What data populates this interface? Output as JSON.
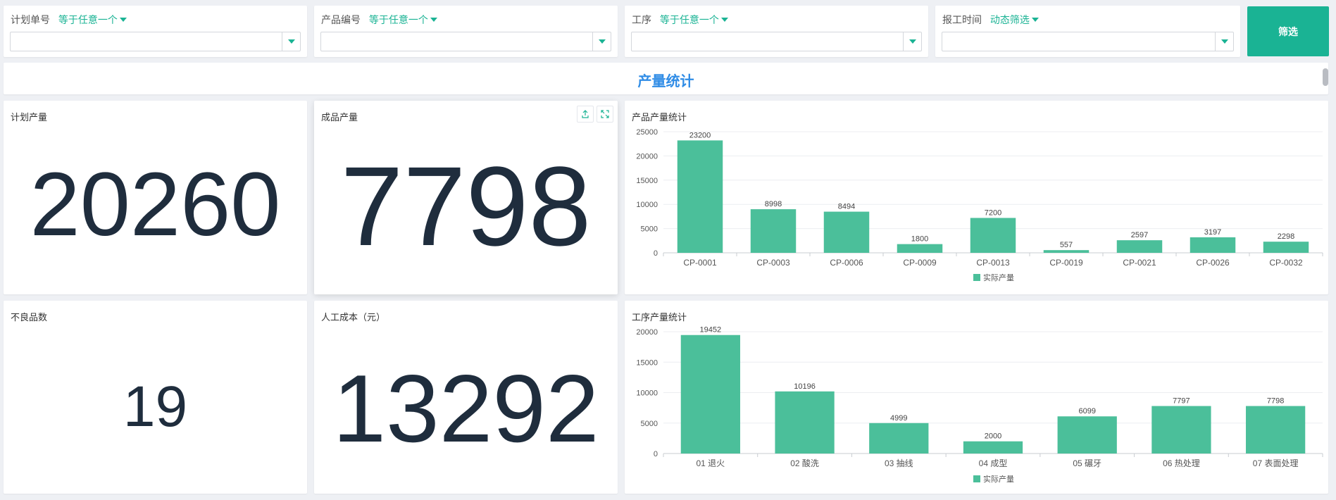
{
  "filters": [
    {
      "label": "计划单号",
      "operator": "等于任意一个",
      "value": ""
    },
    {
      "label": "产品编号",
      "operator": "等于任意一个",
      "value": ""
    },
    {
      "label": "工序",
      "operator": "等于任意一个",
      "value": ""
    },
    {
      "label": "报工时间",
      "operator": "动态筛选",
      "value": ""
    }
  ],
  "filter_button": "筛选",
  "page_title": "产量统计",
  "kpis": {
    "planned_output": {
      "title": "计划产量",
      "value": "20260"
    },
    "finished_output": {
      "title": "成品产量",
      "value": "7798"
    },
    "defects": {
      "title": "不良品数",
      "value": "19"
    },
    "labor_cost": {
      "title": "人工成本（元）",
      "value": "13292"
    }
  },
  "colors": {
    "accent": "#1ab394",
    "bar": "#4bbf9a",
    "title_blue": "#2f8ce6",
    "number": "#1f2d3d"
  },
  "icons": {
    "export": "upload-icon",
    "fullscreen": "expand-icon"
  },
  "chart_data": [
    {
      "type": "bar",
      "title": "产品产量统计",
      "categories": [
        "CP-0001",
        "CP-0003",
        "CP-0006",
        "CP-0009",
        "CP-0013",
        "CP-0019",
        "CP-0021",
        "CP-0026",
        "CP-0032"
      ],
      "series": [
        {
          "name": "实际产量",
          "values": [
            23200,
            8998,
            8494,
            1800,
            7200,
            557,
            2597,
            3197,
            2298
          ]
        }
      ],
      "yticks": [
        0,
        5000,
        10000,
        15000,
        20000,
        25000
      ],
      "ylim": [
        0,
        25000
      ],
      "grid": true,
      "legend": "bottom-center"
    },
    {
      "type": "bar",
      "title": "工序产量统计",
      "categories": [
        "01 退火",
        "02 酸洗",
        "03 抽线",
        "04 成型",
        "05 碾牙",
        "06 热处理",
        "07 表面处理"
      ],
      "series": [
        {
          "name": "实际产量",
          "values": [
            19452,
            10196,
            4999,
            2000,
            6099,
            7797,
            7798
          ]
        }
      ],
      "yticks": [
        0,
        5000,
        10000,
        15000,
        20000
      ],
      "ylim": [
        0,
        20000
      ],
      "grid": true,
      "legend": "bottom-center"
    }
  ]
}
